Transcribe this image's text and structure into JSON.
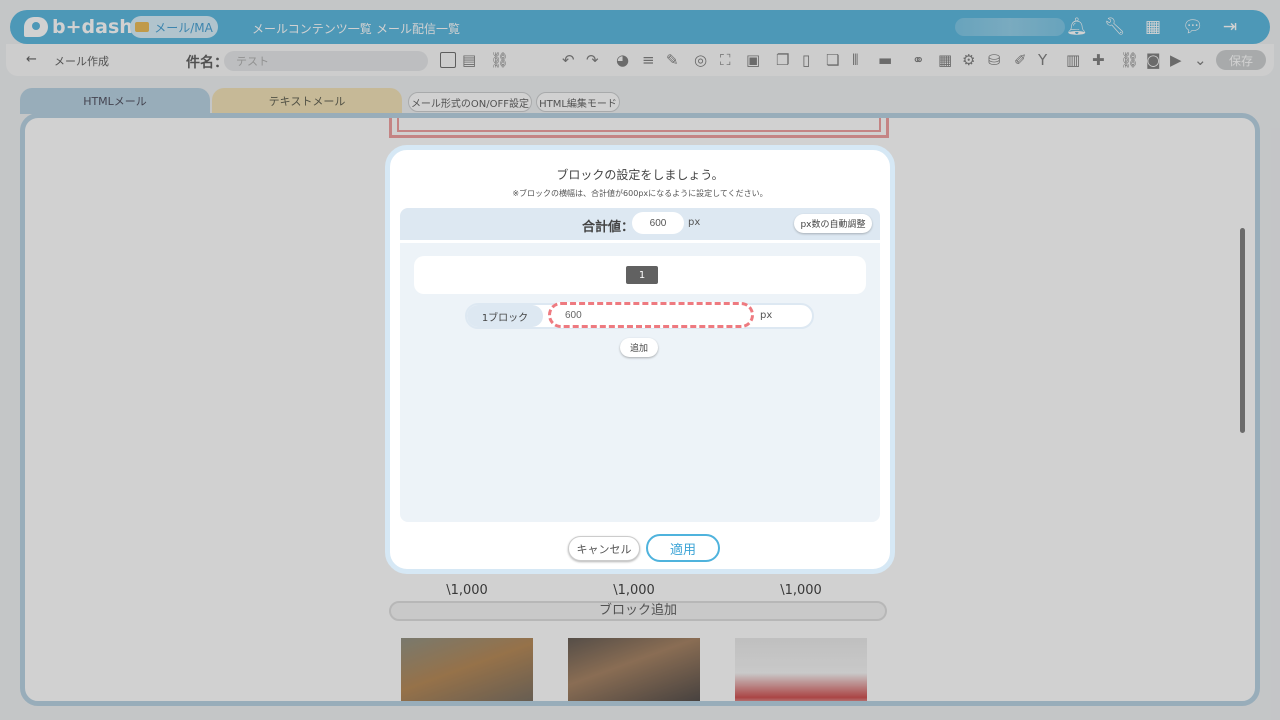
{
  "header": {
    "logo_text": "b+dash",
    "mail_pill_label": "メール/MA",
    "nav_links": [
      "メールコンテンツ一覧",
      "メール配信一覧"
    ],
    "icons": [
      "bell-icon",
      "wrench-icon",
      "grid-icon",
      "chat-icon",
      "logout-icon"
    ]
  },
  "subbar": {
    "back_arrow": "←",
    "title": "メール作成",
    "subject_label": "件名：",
    "subject_value": "テスト",
    "save_label": "保存"
  },
  "tabs": {
    "html_mail": "HTMLメール",
    "text_mail": "テキストメール",
    "onoff": "メール形式のON/OFF設定",
    "html_edit": "HTML編集モード"
  },
  "background": {
    "prices": [
      "\\1,000",
      "\\1,000",
      "\\1,000"
    ],
    "add_block": "ブロック追加"
  },
  "modal": {
    "title": "ブロックの設定をしましょう。",
    "note": "※ブロックの横幅は、合計値が600pxになるように設定してください。",
    "total_label": "合計値：",
    "total_value": "600",
    "unit": "px",
    "auto_adjust": "px数の自動調整",
    "preview_block_number": "1",
    "block_label": "1ブロック",
    "block_value": "600",
    "block_unit": "px",
    "add_label": "追加",
    "cancel_label": "キャンセル",
    "apply_label": "適用"
  },
  "colors": {
    "brand": "#4fb3dd",
    "html_tab": "#b3cfe0",
    "text_tab": "#f0dfb2",
    "highlight_dash": "#ee7a80"
  }
}
